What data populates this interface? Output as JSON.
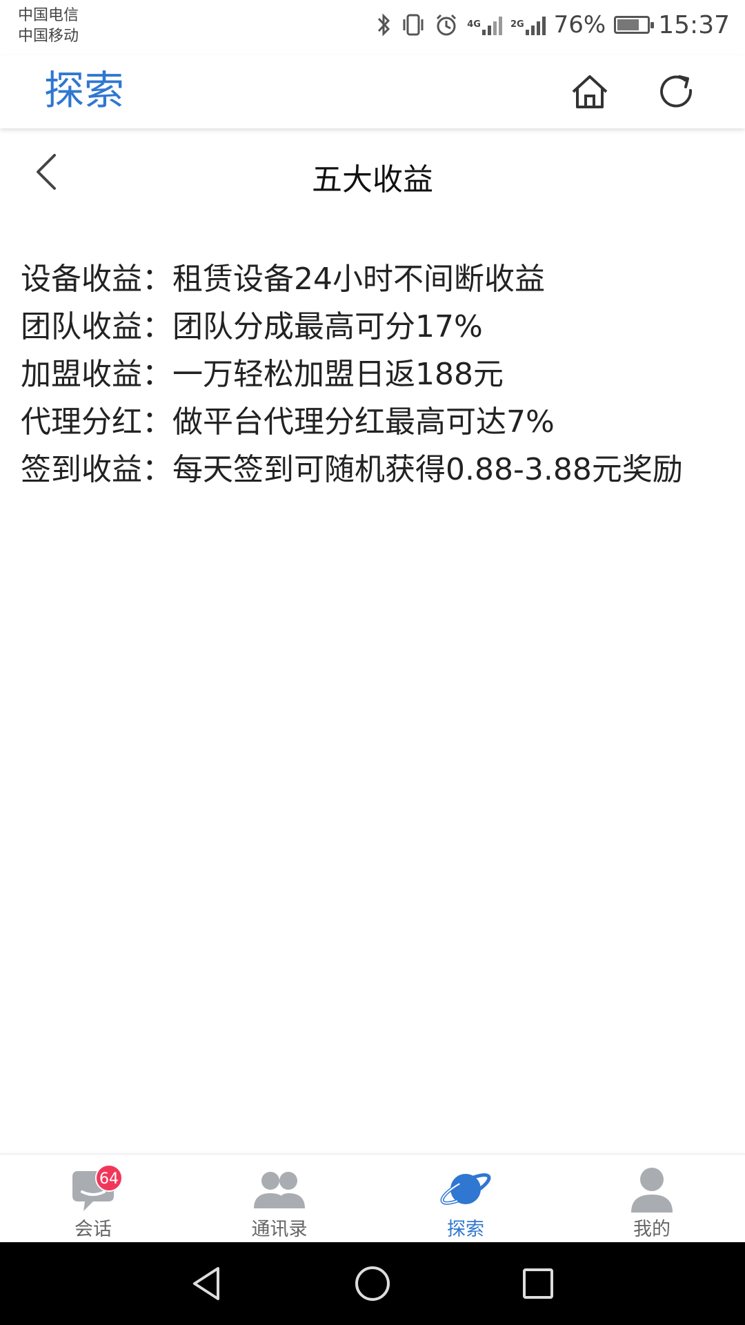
{
  "status": {
    "carrier1": "中国电信",
    "carrier2": "中国移动",
    "net1": "4G",
    "net2": "2G",
    "battery": "76%",
    "battery_level": 0.76,
    "time": "15:37"
  },
  "appbar": {
    "title": "探索"
  },
  "page": {
    "title": "五大收益"
  },
  "content": {
    "lines": [
      "设备收益：租赁设备24小时不间断收益",
      "团队收益：团队分成最高可分17%",
      "加盟收益：一万轻松加盟日返188元",
      "代理分红：做平台代理分红最高可达7%",
      "签到收益：每天签到可随机获得0.88-3.88元奖励"
    ]
  },
  "tabs": [
    {
      "label": "会话",
      "icon": "chat-icon",
      "badge": "64"
    },
    {
      "label": "通讯录",
      "icon": "contacts-icon"
    },
    {
      "label": "探索",
      "icon": "planet-icon",
      "active": true
    },
    {
      "label": "我的",
      "icon": "profile-icon"
    }
  ],
  "colors": {
    "accent": "#2f77d1",
    "badge": "#f2365a",
    "icon_gray": "#a9adb2"
  }
}
